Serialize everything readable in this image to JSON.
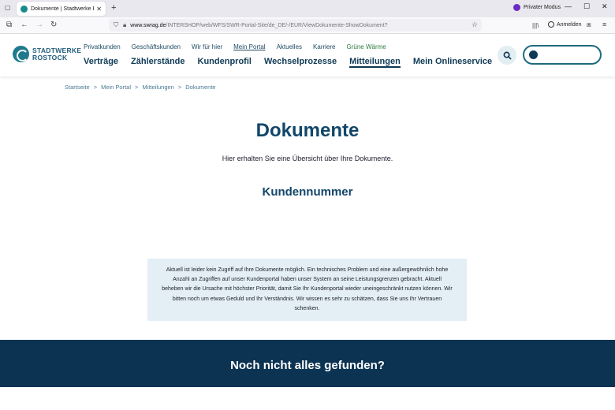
{
  "browser": {
    "tab_title": "Dokumente | Stadtwerke Rostock",
    "url_host": "www.swrag.de",
    "url_path": "/INTERSHOP/web/WFS/SWR-Portal-Site/de_DE/-/EUR/ViewDokumente-ShowDokument?",
    "private_label": "Privater Modus",
    "signin_label": "Anmelden"
  },
  "logo": {
    "line1": "STADTWERKE",
    "line2": "ROSTOCK"
  },
  "top_nav": [
    {
      "label": "Privatkunden"
    },
    {
      "label": "Geschäftskunden"
    },
    {
      "label": "Wir für hier"
    },
    {
      "label": "Mein Portal"
    },
    {
      "label": "Aktuelles"
    },
    {
      "label": "Karriere"
    },
    {
      "label": "Grüne Wärme"
    }
  ],
  "main_nav": [
    {
      "label": "Verträge"
    },
    {
      "label": "Zählerstände"
    },
    {
      "label": "Kundenprofil"
    },
    {
      "label": "Wechselprozesse"
    },
    {
      "label": "Mitteilungen"
    },
    {
      "label": "Mein Onlineservice"
    }
  ],
  "breadcrumb": [
    "Startseite",
    "Mein Portal",
    "Mitteilungen",
    "Dokumente"
  ],
  "breadcrumb_sep": ">",
  "content": {
    "title": "Dokumente",
    "subtitle": "Hier erhalten Sie eine Übersicht über Ihre Dokumente.",
    "section_title": "Kundennummer",
    "notice": "Aktuell ist leider kein Zugriff auf Ihre Dokumente möglich. Ein technisches Problem und eine außergewöhnlich hohe Anzahl an Zugriffen auf unser Kundenportal haben unser System an seine Leistungsgrenzen gebracht. Aktuell beheben wir die Ursache mit höchster Priorität, damit Sie Ihr Kundenportal wieder uneingeschränkt nutzen können. Wir bitten noch um etwas Geduld und Ihr Verständnis. Wir wissen es sehr zu schätzen, dass Sie uns Ihr Vertrauen schenken."
  },
  "footer": {
    "title": "Noch nicht alles gefunden?"
  },
  "colors": {
    "brand_dark": "#0c3352",
    "brand_teal": "#1f7a8c",
    "notice_bg": "#e3eff4"
  }
}
